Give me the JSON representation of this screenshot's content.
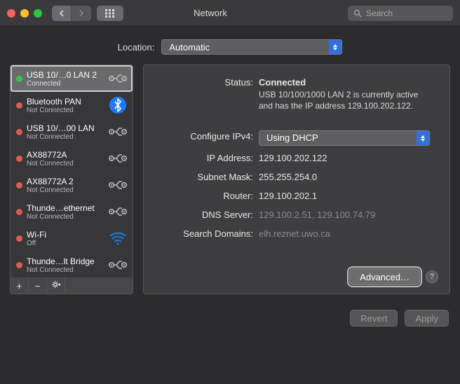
{
  "window": {
    "title": "Network",
    "search_placeholder": "Search"
  },
  "location": {
    "label": "Location:",
    "value": "Automatic"
  },
  "sidebar": {
    "items": [
      {
        "name": "USB 10/…0 LAN 2",
        "status": "Connected",
        "dot": "green",
        "icon": "ethernet",
        "selected": true
      },
      {
        "name": "Bluetooth PAN",
        "status": "Not Connected",
        "dot": "red",
        "icon": "bluetooth"
      },
      {
        "name": "USB 10/…00 LAN",
        "status": "Not Connected",
        "dot": "red",
        "icon": "ethernet"
      },
      {
        "name": "AX88772A",
        "status": "Not Connected",
        "dot": "red",
        "icon": "ethernet"
      },
      {
        "name": "AX88772A 2",
        "status": "Not Connected",
        "dot": "red",
        "icon": "ethernet"
      },
      {
        "name": "Thunde…ethernet",
        "status": "Not Connected",
        "dot": "red",
        "icon": "ethernet"
      },
      {
        "name": "Wi-Fi",
        "status": "Off",
        "dot": "red",
        "icon": "wifi"
      },
      {
        "name": "Thunde…lt Bridge",
        "status": "Not Connected",
        "dot": "red",
        "icon": "ethernet"
      }
    ],
    "actions": {
      "add": "+",
      "remove": "−",
      "gear": "⚙"
    }
  },
  "detail": {
    "status_label": "Status:",
    "status_value": "Connected",
    "status_desc": "USB 10/100/1000 LAN 2 is currently active and has the IP address 129.100.202.122.",
    "configure_label": "Configure IPv4:",
    "configure_value": "Using DHCP",
    "ip_label": "IP Address:",
    "ip_value": "129.100.202.122",
    "subnet_label": "Subnet Mask:",
    "subnet_value": "255.255.254.0",
    "router_label": "Router:",
    "router_value": "129.100.202.1",
    "dns_label": "DNS Server:",
    "dns_value": "129.100.2.51, 129.100.74.79",
    "search_label": "Search Domains:",
    "search_value": "elh.reznet.uwo.ca",
    "advanced": "Advanced…",
    "help": "?"
  },
  "footer": {
    "revert": "Revert",
    "apply": "Apply"
  }
}
